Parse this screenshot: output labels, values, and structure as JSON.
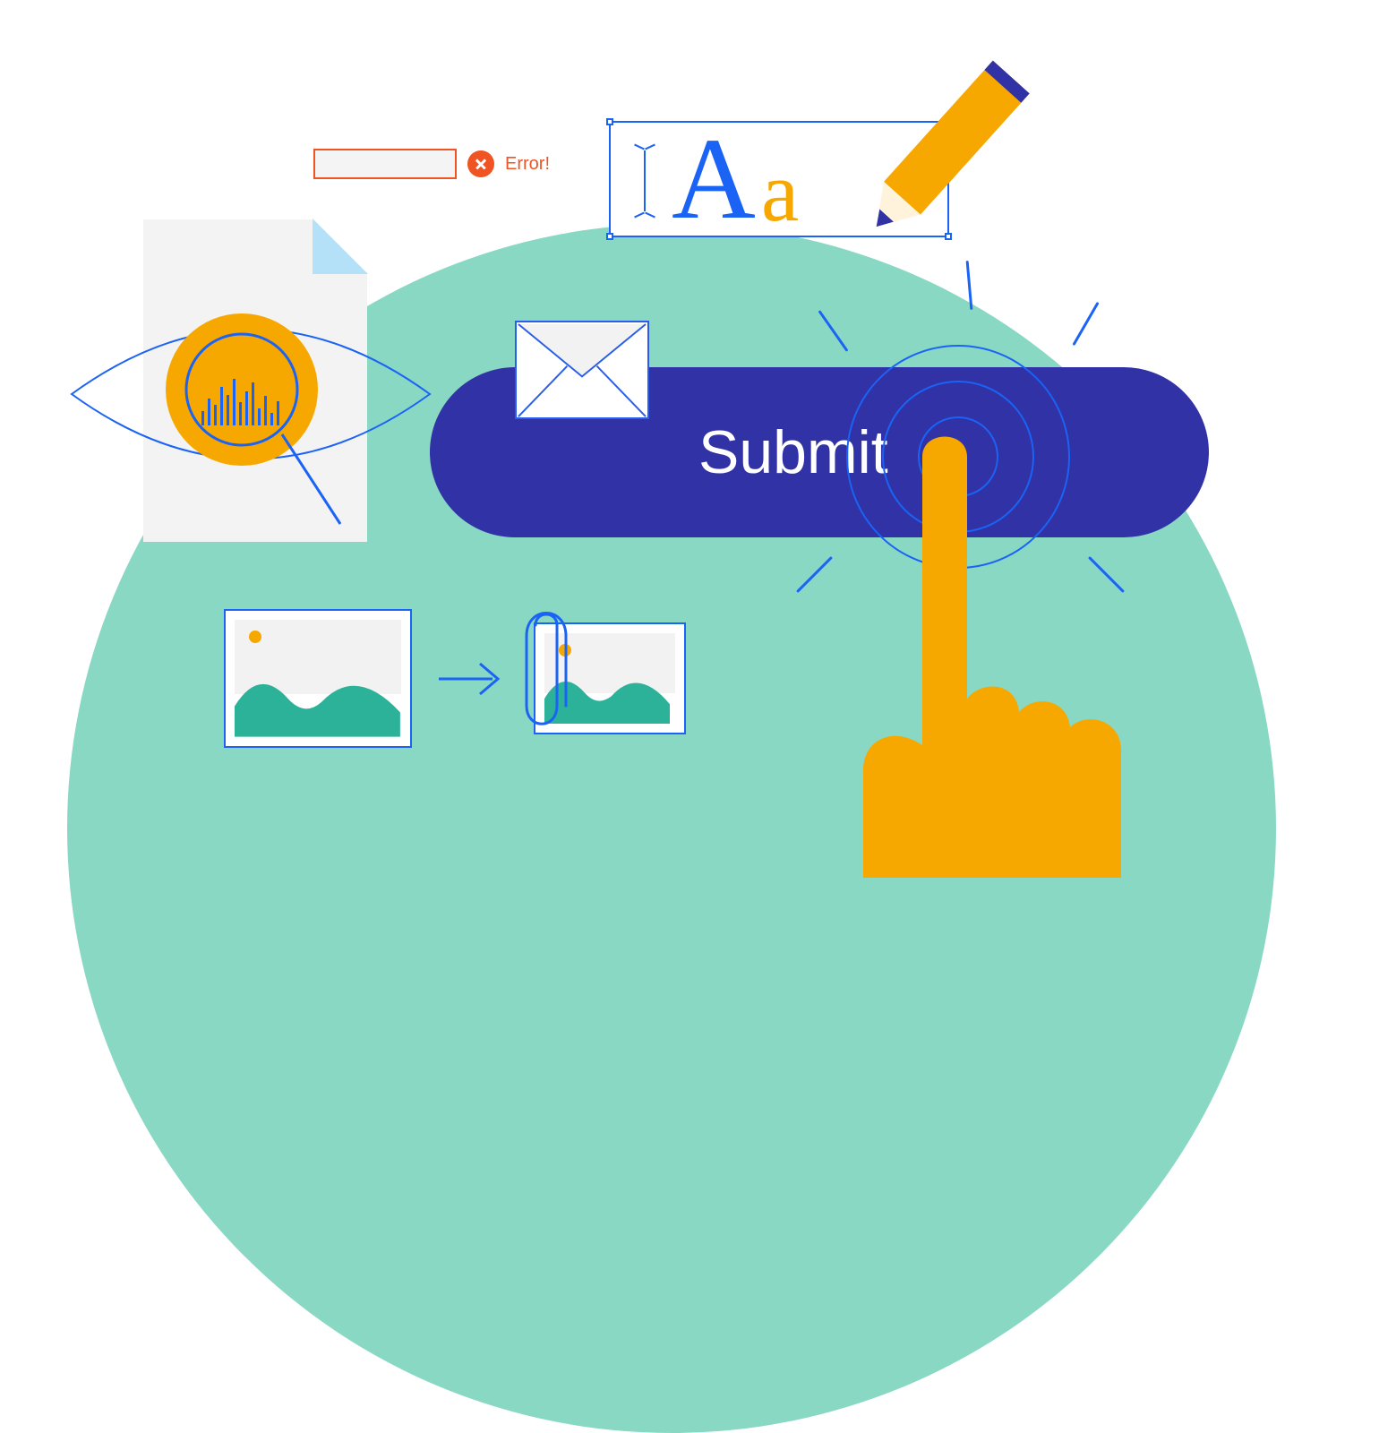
{
  "error": {
    "label": "Error!"
  },
  "textbox": {
    "sample_upper": "A",
    "sample_lower": "a"
  },
  "button": {
    "label": "Submit"
  },
  "colors": {
    "teal": "#89d8c4",
    "indigo": "#3032a6",
    "blue": "#1b63f5",
    "orange": "#f7a800",
    "error": "#f05423"
  }
}
